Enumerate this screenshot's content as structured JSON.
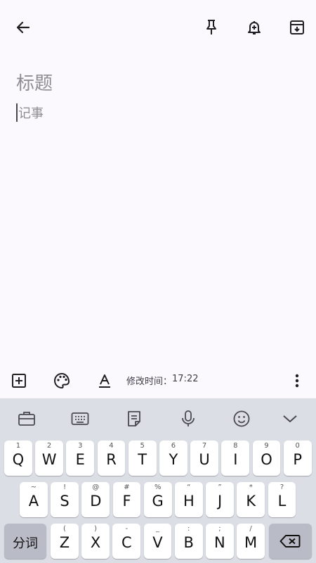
{
  "editor": {
    "title_placeholder": "标题",
    "body_placeholder": "记事"
  },
  "header_icons": [
    "back-arrow-icon",
    "pin-icon",
    "reminder-bell-icon",
    "archive-icon"
  ],
  "bottom_bar": {
    "modified_label": "修改时间：",
    "modified_time": "17:22"
  },
  "keyboard": {
    "toolbar_icons": [
      "briefcase-icon",
      "keyboard-icon",
      "clipboard-icon",
      "microphone-icon",
      "emoji-icon",
      "chevron-down-icon"
    ],
    "row1": {
      "keys": [
        "Q",
        "W",
        "E",
        "R",
        "T",
        "Y",
        "U",
        "I",
        "O",
        "P"
      ],
      "hints": [
        "1",
        "2",
        "3",
        "4",
        "5",
        "6",
        "7",
        "8",
        "9",
        "0"
      ]
    },
    "row2": {
      "keys": [
        "A",
        "S",
        "D",
        "F",
        "G",
        "H",
        "J",
        "K",
        "L"
      ],
      "hints": [
        "~",
        "!",
        "@",
        "#",
        "%",
        "“",
        "”",
        "*",
        "?"
      ]
    },
    "row3": {
      "keys": [
        "Z",
        "X",
        "C",
        "V",
        "B",
        "N",
        "M"
      ],
      "hints": [
        "(",
        ")",
        "-",
        "_",
        ":",
        ";",
        "/"
      ]
    },
    "segment_label": "分词"
  },
  "colors": {
    "background": "#fbf8fe",
    "keyboard_bg": "#dcdee6",
    "key_bg": "#ffffff",
    "function_key_bg": "#b9bcc6",
    "placeholder": "#8f8d94"
  }
}
